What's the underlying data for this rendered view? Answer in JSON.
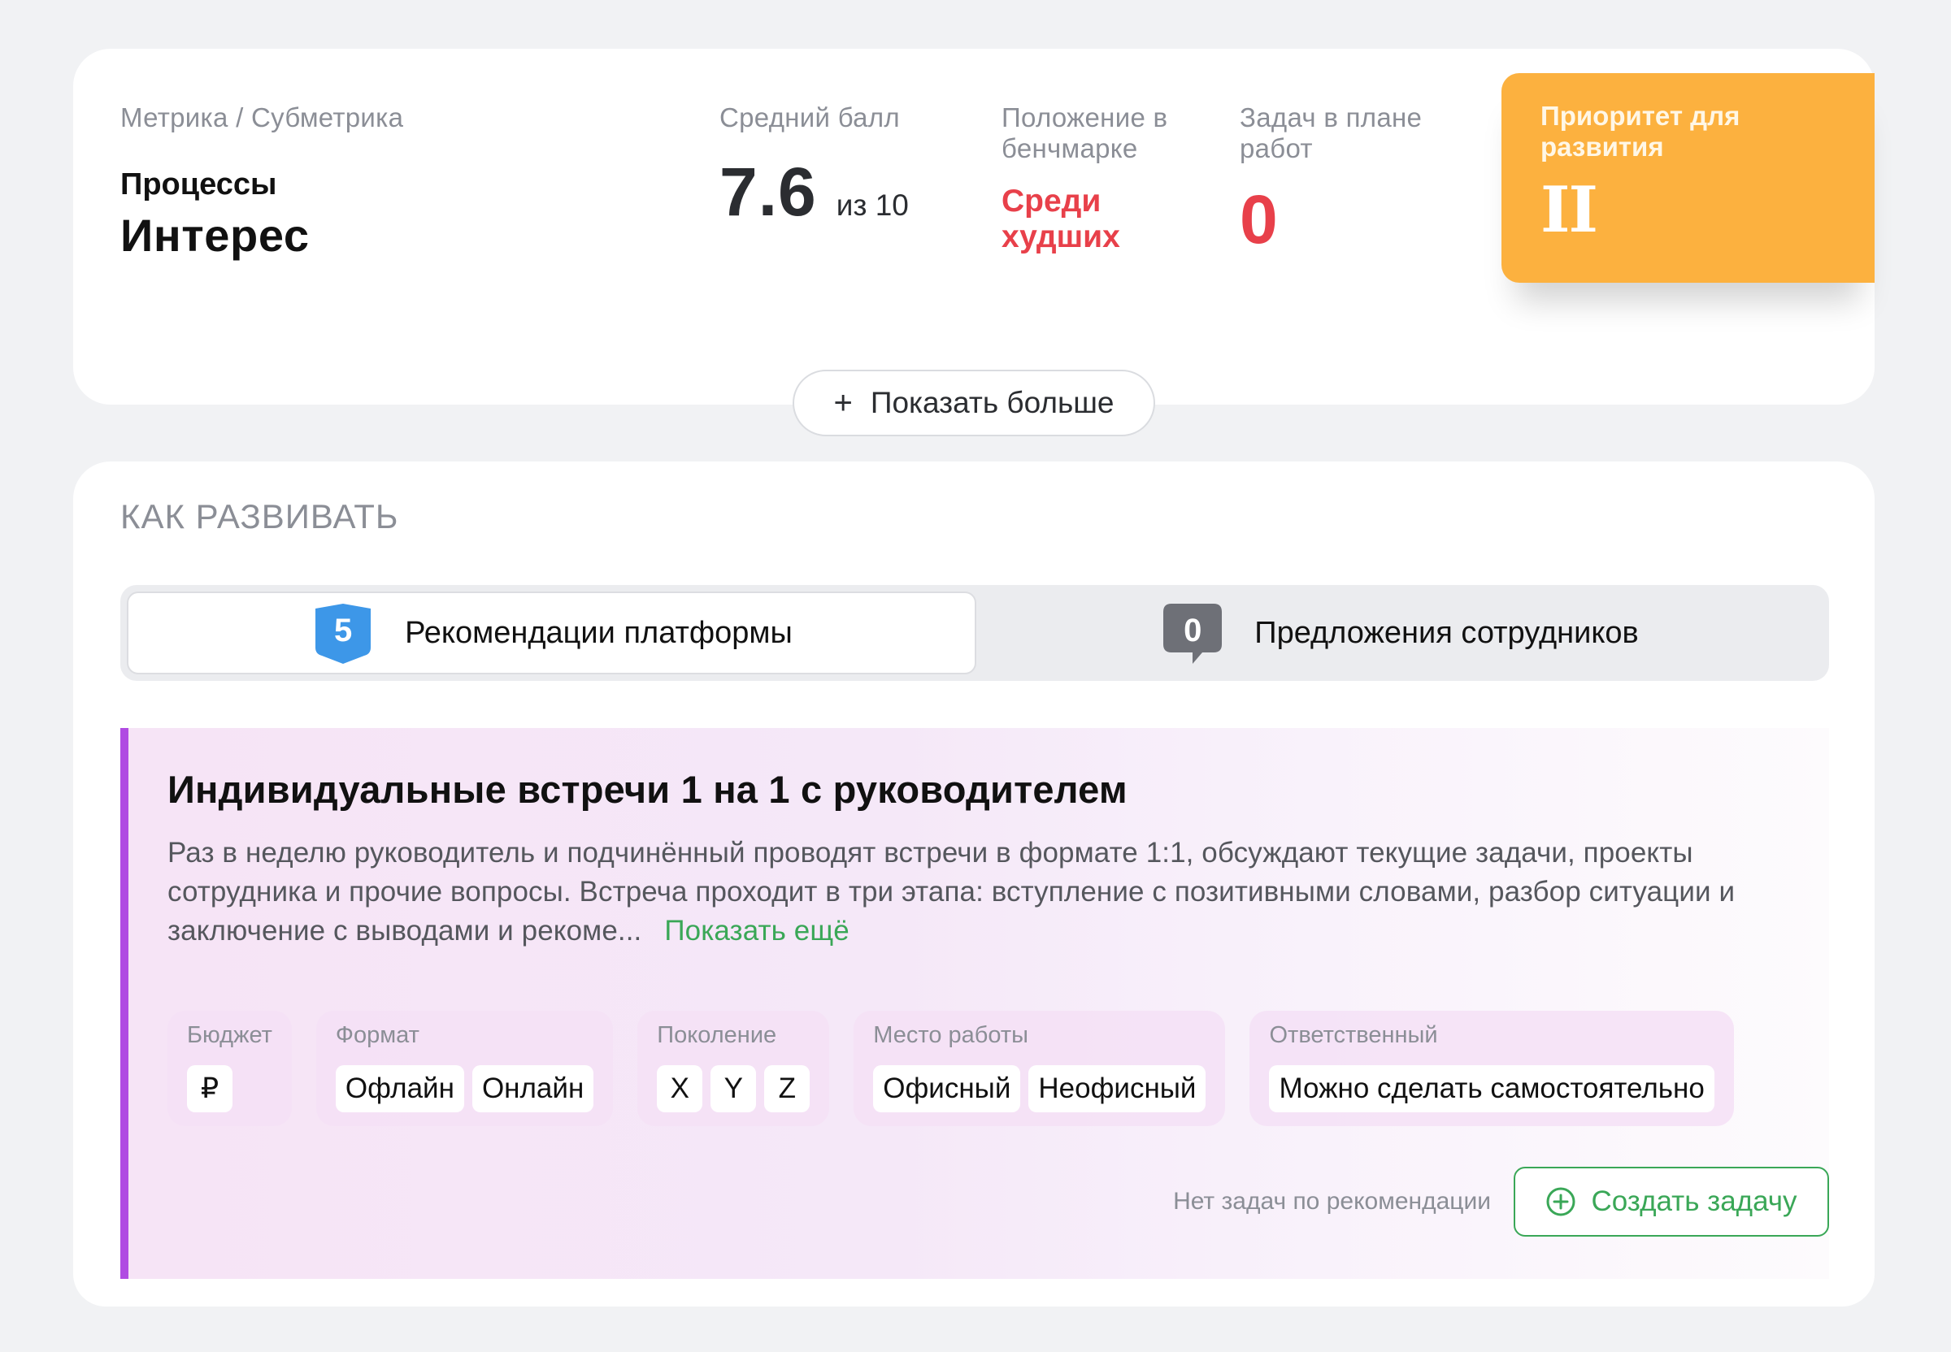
{
  "metric": {
    "caption": "Метрика / Субметрика",
    "group": "Процессы",
    "name": "Интерес"
  },
  "score": {
    "caption": "Средний балл",
    "value": "7.6",
    "max": "из 10"
  },
  "benchmark": {
    "caption": "Положение в бенчмарке",
    "value": "Среди худших"
  },
  "tasks": {
    "caption": "Задач в плане работ",
    "value": "0"
  },
  "priority": {
    "label": "Приоритет для развития",
    "value": "II"
  },
  "show_more": {
    "icon": "+",
    "label": "Показать больше"
  },
  "howto": {
    "title": "КАК РАЗВИВАТЬ",
    "tabs": [
      {
        "count": "5",
        "label": "Рекомендации платформы",
        "active": true,
        "badge_color": "#3d97e8"
      },
      {
        "count": "0",
        "label": "Предложения сотрудников",
        "active": false,
        "badge_color": "#6e7077"
      }
    ]
  },
  "recommendation": {
    "title": "Индивидуальные встречи 1 на 1 с руководителем",
    "description": "Раз в неделю руководитель и подчинённый проводят встречи в формате 1:1, обсуждают текущие задачи, проекты сотрудника и прочие вопросы. Встреча проходит в три этапа: вступление с позитивными словами, разбор ситуации и заключение с выводами и рекоме...",
    "more_link": "Показать ещё",
    "groups": [
      {
        "label": "Бюджет",
        "chips": [
          "₽"
        ]
      },
      {
        "label": "Формат",
        "chips": [
          "Офлайн",
          "Онлайн"
        ]
      },
      {
        "label": "Поколение",
        "chips": [
          "X",
          "Y",
          "Z"
        ]
      },
      {
        "label": "Место работы",
        "chips": [
          "Офисный",
          "Неофисный"
        ]
      },
      {
        "label": "Ответственный",
        "chips": [
          "Можно сделать самостоятельно"
        ]
      }
    ],
    "no_tasks": "Нет задач по рекомендации",
    "create_task": "Создать задачу"
  },
  "colors": {
    "accent_green": "#3aa757",
    "danger_red": "#e8404a",
    "priority_orange": "#fcb13f",
    "rec_border": "#b04be2"
  }
}
